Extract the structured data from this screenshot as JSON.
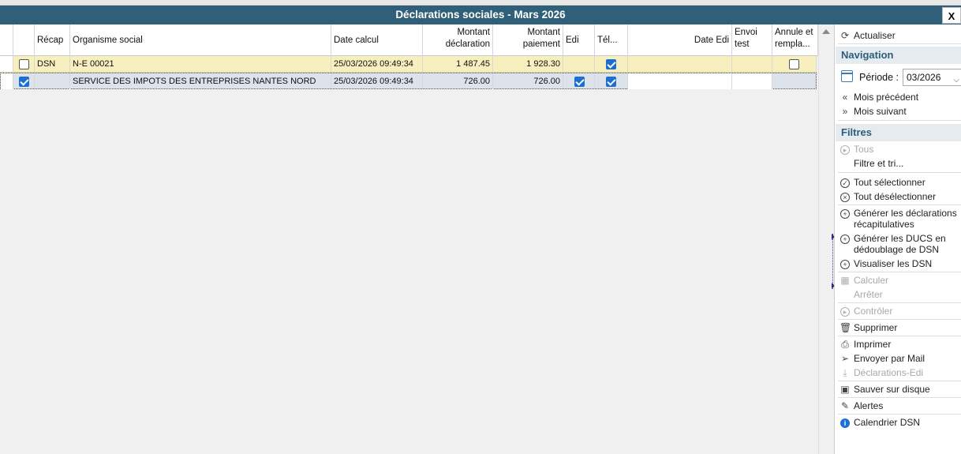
{
  "window": {
    "title": "Déclarations sociales - Mars 2026",
    "close_label": "X"
  },
  "grid": {
    "headers": {
      "recap": "Récap",
      "organisme": "Organisme social",
      "date_calcul": "Date calcul",
      "montant_declaration": "Montant déclaration",
      "montant_paiement": "Montant paiement",
      "edi": "Edi",
      "tel": "Tél...",
      "date_edi": "Date Edi",
      "envoi_test": "Envoi test",
      "annule": "Annule et rempla..."
    },
    "rows": [
      {
        "selected": false,
        "recap": "DSN",
        "organisme": "N-E  00021",
        "date_calcul": "25/03/2026 09:49:34",
        "montant_declaration": "1 487.45",
        "montant_paiement": "1 928.30",
        "edi": null,
        "tel": true,
        "date_edi": "",
        "envoi_test": "",
        "annule": false
      },
      {
        "selected": true,
        "recap": "",
        "organisme": "SERVICE DES IMPOTS DES ENTREPRISES NANTES NORD",
        "date_calcul": "25/03/2026 09:49:34",
        "montant_declaration": "726.00",
        "montant_paiement": "726.00",
        "edi": true,
        "tel": true,
        "date_edi": "",
        "envoi_test": "",
        "annule": null
      }
    ]
  },
  "panel": {
    "refresh": "Actualiser",
    "navigation": {
      "title": "Navigation",
      "period_label": "Période :",
      "period_value": "03/2026",
      "prev": "Mois précédent",
      "next": "Mois suivant"
    },
    "filters": {
      "title": "Filtres",
      "all": "Tous",
      "filter_sort": "Filtre et tri..."
    },
    "actions": {
      "select_all": "Tout sélectionner",
      "deselect_all": "Tout désélectionner",
      "gen_recap": "Générer les déclarations récapitulatives",
      "gen_ducs": "Générer les DUCS en dédoublage de DSN",
      "view_dsn": "Visualiser les DSN",
      "calculate": "Calculer",
      "stop": "Arrêter",
      "control": "Contrôler",
      "delete": "Supprimer",
      "print": "Imprimer",
      "send_mail": "Envoyer par Mail",
      "edi_declarations": "Déclarations-Edi",
      "save_disk": "Sauver sur disque",
      "alerts": "Alertes",
      "calendar": "Calendrier DSN"
    }
  }
}
